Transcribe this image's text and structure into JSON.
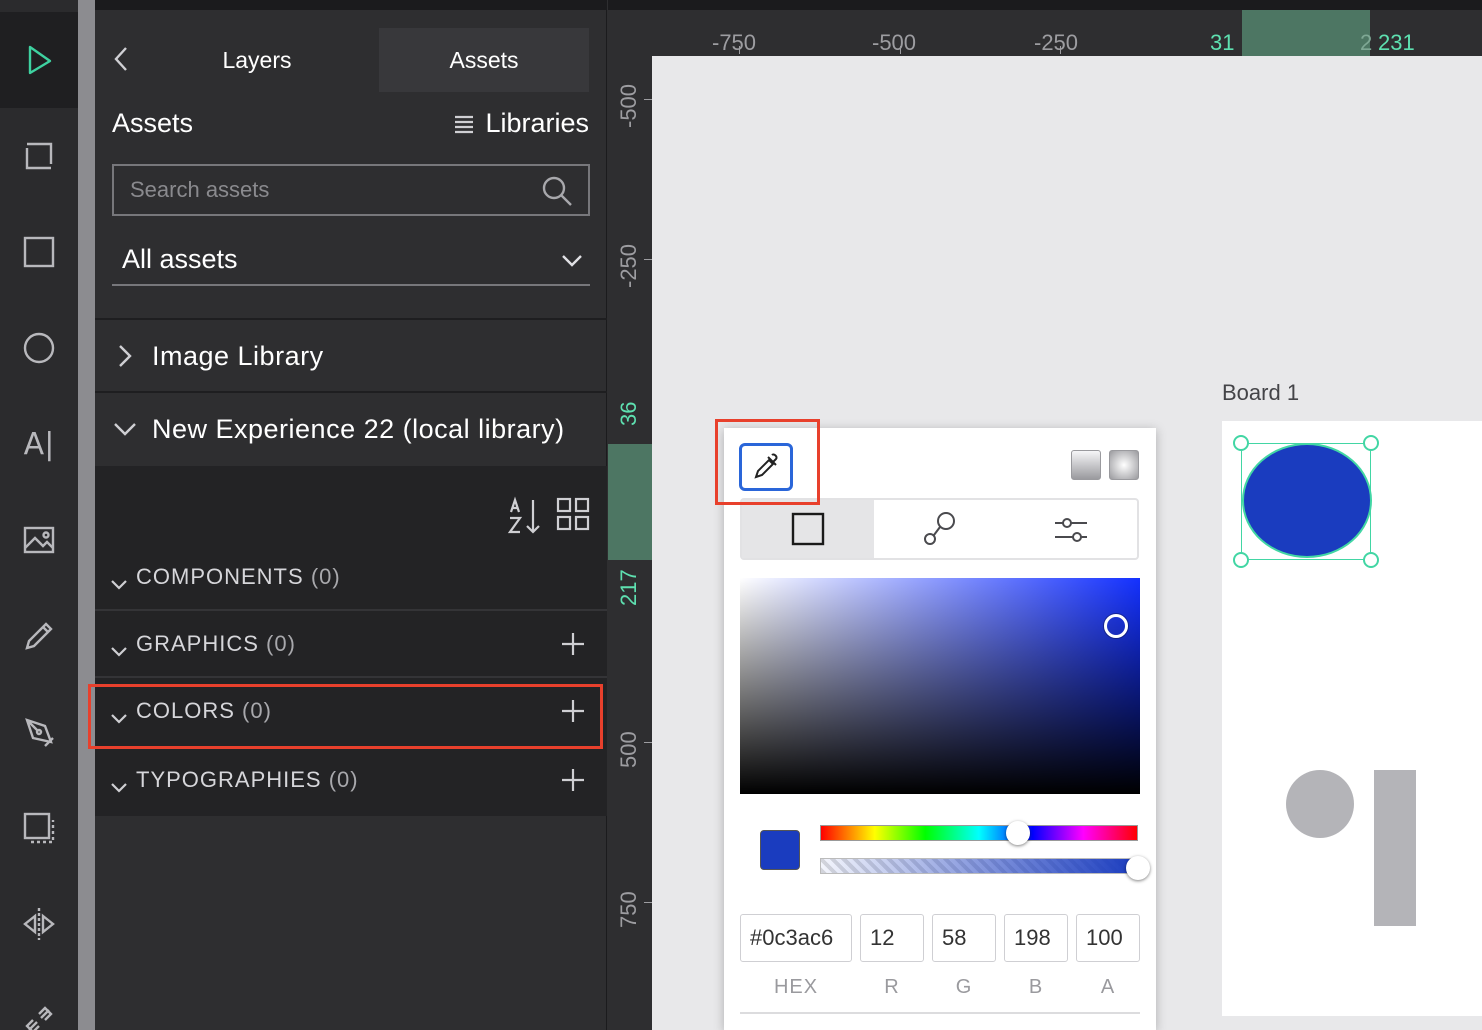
{
  "toolbar": {
    "tools": [
      "select-tool",
      "board-tool",
      "rectangle-tool",
      "ellipse-tool",
      "text-tool",
      "image-tool",
      "pencil-tool",
      "pen-tool",
      "component-tool",
      "mirror-tool",
      "link-tool"
    ],
    "text_tool_glyph": "A|",
    "active": "select-tool",
    "accent": "#3ed1a0"
  },
  "panel": {
    "tabs": {
      "layers": "Layers",
      "assets": "Assets"
    },
    "assets_title": "Assets",
    "libraries_label": "Libraries",
    "search": {
      "placeholder": "Search assets",
      "value": ""
    },
    "filter": {
      "selected": "All assets"
    },
    "libraries": [
      {
        "label": "Image Library",
        "expanded": false
      },
      {
        "label": "New Experience 22 (local library)",
        "expanded": true
      }
    ],
    "sections": [
      {
        "label": "COMPONENTS",
        "count": "(0)",
        "has_add": false
      },
      {
        "label": "GRAPHICS",
        "count": "(0)",
        "has_add": true
      },
      {
        "label": "COLORS",
        "count": "(0)",
        "has_add": true,
        "highlighted": true
      },
      {
        "label": "TYPOGRAPHIES",
        "count": "(0)",
        "has_add": true
      }
    ]
  },
  "rulers": {
    "top": [
      "-750",
      "-500",
      "-250",
      "31",
      "2",
      "231"
    ],
    "left": [
      "-500",
      "-250",
      "36",
      "217",
      "500",
      "750"
    ],
    "selection_color": "#4d7663"
  },
  "canvas": {
    "board_label": "Board 1",
    "ellipse_fill": "#1a3cbf"
  },
  "color_picker": {
    "hex": "#0c3ac6",
    "r": "12",
    "g": "58",
    "b": "198",
    "a": "100",
    "labels": {
      "hex": "HEX",
      "r": "R",
      "g": "G",
      "b": "B",
      "a": "A"
    },
    "hue_fraction": 0.64,
    "alpha_fraction": 1.0,
    "highlight_color": "#e8402c"
  }
}
